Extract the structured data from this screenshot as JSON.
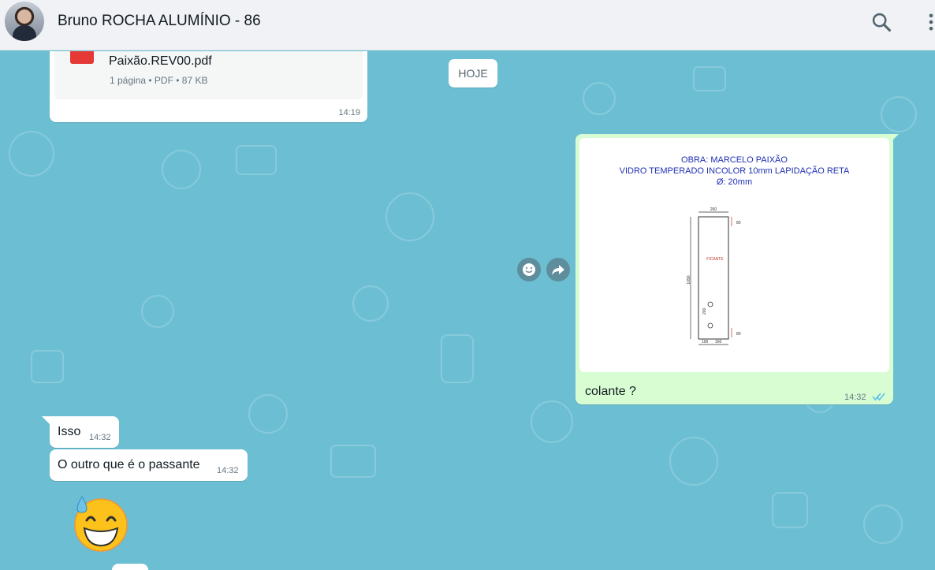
{
  "header": {
    "contact_name": "Bruno ROCHA ALUMÍNIO - 86",
    "icons": [
      "search-icon",
      "menu-icon"
    ]
  },
  "chat": {
    "date_chip": "HOJE",
    "pdf_message": {
      "file_name": "Paixão.REV00.pdf",
      "meta": "1 página • PDF • 87 KB",
      "time": "14:19"
    },
    "image_message": {
      "drawing": {
        "line1": "OBRA: MARCELO PAIXÃO",
        "line2": "VIDRO TEMPERADO INCOLOR 10mm LAPIDAÇÃO RETA",
        "line3": "Ø: 20mm",
        "width_top": "260",
        "height": "1090",
        "label": "FICANTE",
        "dim_80a": "80",
        "dim_80b": "80",
        "dim_200": "200",
        "dim_100": "100",
        "dim_160": "160"
      },
      "caption": "colante ?",
      "time": "14:32",
      "status": "read"
    },
    "incoming": [
      {
        "text": "Isso",
        "time": "14:32"
      },
      {
        "text": "O outro que é o passante",
        "time": "14:32"
      }
    ],
    "emoji": "😅"
  },
  "colors": {
    "chat_background": "#6cbfd3",
    "outgoing_bubble": "#d9fdd3",
    "incoming_bubble": "#ffffff",
    "read_ticks": "#53bdeb"
  }
}
